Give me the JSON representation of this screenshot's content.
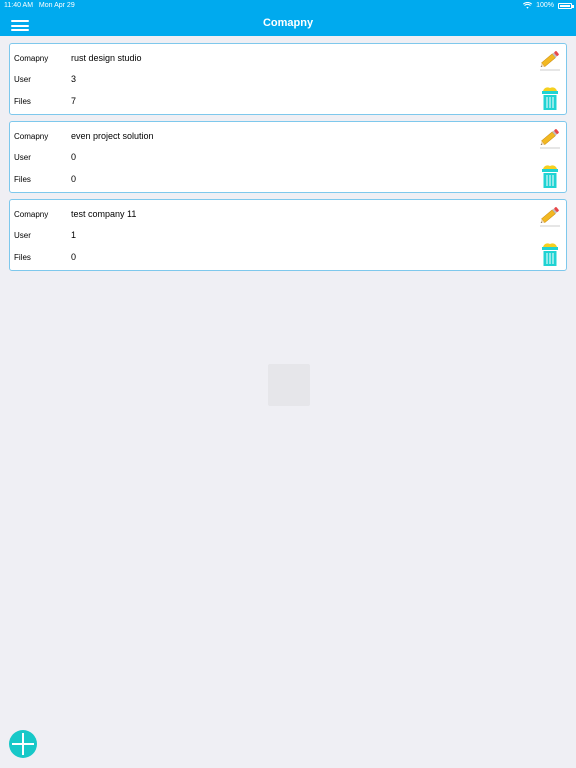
{
  "status": {
    "time": "11:40 AM",
    "date": "Mon Apr 29",
    "battery": "100%"
  },
  "nav": {
    "title": "Comapny"
  },
  "labels": {
    "company": "Comapny",
    "user": "User",
    "files": "Files"
  },
  "companies": [
    {
      "name": "rust design studio",
      "users": "3",
      "files": "7"
    },
    {
      "name": "even project solution",
      "users": "0",
      "files": "0"
    },
    {
      "name": "test company 11",
      "users": "1",
      "files": "0"
    }
  ],
  "colors": {
    "accent": "#00aaee",
    "fab": "#17c8c8",
    "card_border": "#7ec8ec"
  },
  "icons": {
    "menu": "hamburger-menu-icon",
    "edit": "pencil-icon",
    "delete": "trash-icon",
    "add": "plus-icon",
    "wifi": "wifi-icon",
    "battery": "battery-icon"
  }
}
